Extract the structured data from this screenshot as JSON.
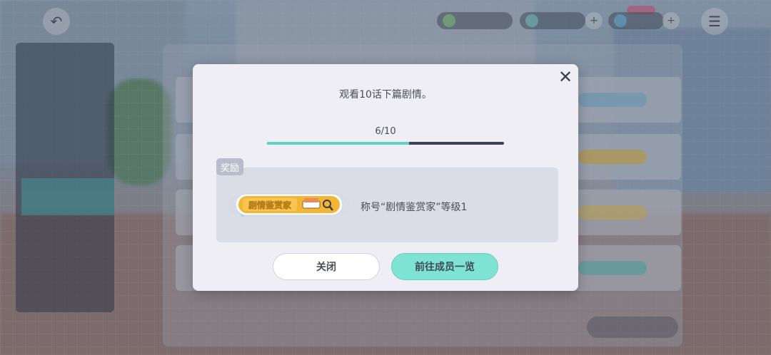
{
  "modal": {
    "mission_text": "观看10话下篇剧情。",
    "progress_text": "6/10",
    "progress": {
      "current": 6,
      "total": 10,
      "fill_color": "#5ed2c8",
      "track_color": "#3f4156"
    },
    "reward_label": "奖励",
    "reward_badge_text": "剧情鉴赏家",
    "reward_badge_color": "#f2b534",
    "reward_description": "称号“剧情鉴赏家”等级1",
    "close_icon": "close-icon",
    "buttons": {
      "close_label": "关闭",
      "go_label": "前往成员一览"
    }
  },
  "colors": {
    "accent": "#7fe3d3",
    "modal_bg": "#eeeef4",
    "text": "#4a4c58"
  }
}
